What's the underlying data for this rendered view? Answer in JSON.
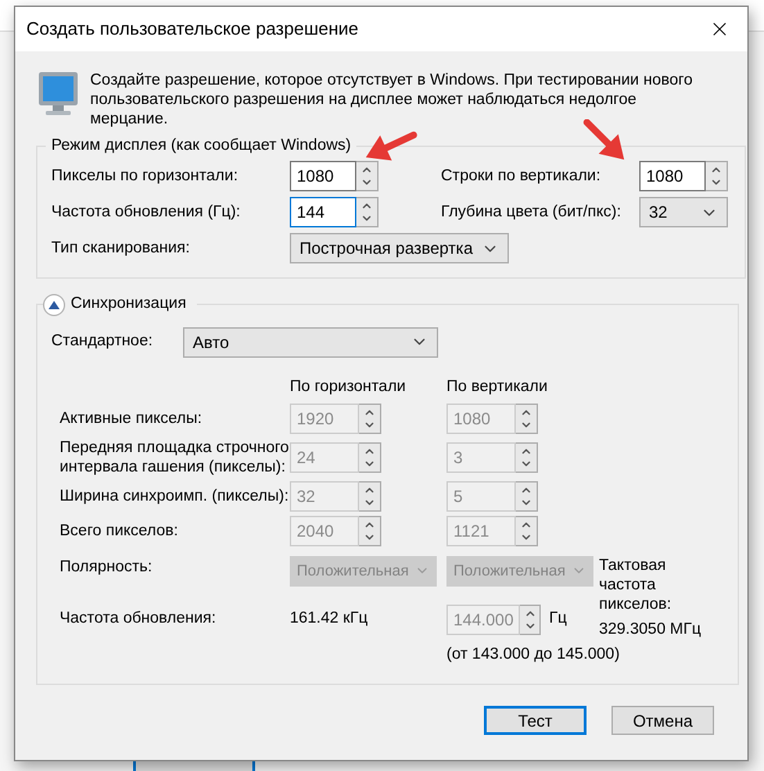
{
  "window": {
    "title": "Создать пользовательское разрешение"
  },
  "description": "Создайте разрешение, которое отсутствует в Windows. При тестировании нового пользовательского разрешения на дисплее может наблюдаться недолгое мерцание.",
  "display_mode": {
    "legend": "Режим дисплея (как сообщает Windows)",
    "horizontal_pixels": {
      "label": "Пикселы по горизонтали:",
      "value": "1080",
      "focused": false
    },
    "vertical_lines": {
      "label": "Строки по вертикали:",
      "value": "1080",
      "focused": false
    },
    "refresh_rate": {
      "label": "Частота обновления (Гц):",
      "value": "144",
      "focused": true
    },
    "color_depth": {
      "label": "Глубина цвета (бит/пкс):",
      "value": "32"
    },
    "scan_type": {
      "label": "Тип сканирования:",
      "value": "Построчная развертка"
    }
  },
  "sync": {
    "legend": "Синхронизация",
    "expanded": true,
    "standard": {
      "label": "Стандартное:",
      "value": "Авто"
    },
    "column_headers": [
      "По горизонтали",
      "По вертикали"
    ],
    "rows": [
      {
        "label": "Активные пикселы:",
        "horizontal": "1920",
        "vertical": "1080",
        "disabled": true
      },
      {
        "label": "Передняя площадка строчного интервала гашения (пикселы):",
        "horizontal": "24",
        "vertical": "3",
        "disabled": true
      },
      {
        "label": "Ширина синхроимп. (пикселы):",
        "horizontal": "32",
        "vertical": "5",
        "disabled": true
      },
      {
        "label": "Всего пикселов:",
        "horizontal": "2040",
        "vertical": "1121",
        "disabled": true
      }
    ],
    "polarity": {
      "label": "Полярность:",
      "horizontal": "Положительная",
      "vertical": "Положительная",
      "disabled": true
    },
    "refresh": {
      "label": "Частота обновления:",
      "horizontal": "161.42 кГц",
      "vertical": "144.000",
      "unit": "Гц",
      "range": "(от 143.000 до 145.000)",
      "disabled": true
    },
    "pixel_clock": {
      "label": "Тактовая частота пикселов:",
      "value": "329.3050 МГц"
    }
  },
  "buttons": [
    {
      "label": "Тест",
      "default": true
    },
    {
      "label": "Отмена",
      "default": false
    }
  ]
}
